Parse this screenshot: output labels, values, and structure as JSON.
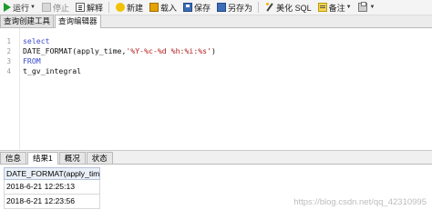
{
  "toolbar": {
    "run": "运行",
    "stop": "停止",
    "explain": "解释",
    "new": "新建",
    "load": "载入",
    "save": "保存",
    "saveas": "另存为",
    "beautify": "美化 SQL",
    "comment": "备注",
    "print": ""
  },
  "editor_tabs": [
    "查询创建工具",
    "查询编辑器"
  ],
  "editor": {
    "lines": [
      {
        "num": "1",
        "text": "select"
      },
      {
        "num": "2",
        "pre": "DATE_FORMAT(apply_time,",
        "str": "'%Y-%c-%d %h:%i:%s'",
        "post": ")"
      },
      {
        "num": "3",
        "text": "FROM"
      },
      {
        "num": "4",
        "text": "t_gv_integral"
      }
    ]
  },
  "bottom_tabs": [
    "信息",
    "结果1",
    "概况",
    "状态"
  ],
  "result": {
    "column": "DATE_FORMAT(apply_tim",
    "rows": [
      "2018-6-21 12:25:13",
      "2018-6-21 12:23:56"
    ]
  },
  "watermark": "https://blog.csdn.net/qq_42310995"
}
